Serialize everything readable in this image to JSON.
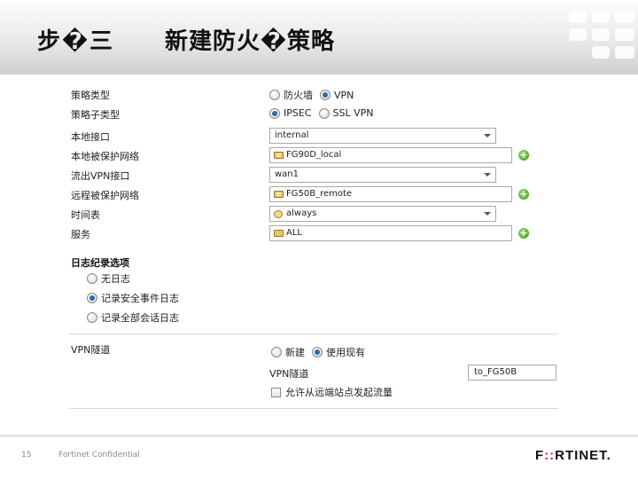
{
  "header": {
    "title_left": "步�三",
    "title_right": "新建防火�策略"
  },
  "form": {
    "policy_type": {
      "label": "策略类型",
      "options": [
        "防火墙",
        "VPN"
      ],
      "selected": "VPN"
    },
    "policy_subtype": {
      "label": "策略子类型",
      "options": [
        "IPSEC",
        "SSL VPN"
      ],
      "selected": "IPSEC"
    },
    "local_interface": {
      "label": "本地接口",
      "value": "internal"
    },
    "local_protected_subnet": {
      "label": "本地被保护网络",
      "value": "FG90D_local"
    },
    "outgoing_vpn_interface": {
      "label": "流出VPN接口",
      "value": "wan1"
    },
    "remote_protected_subnet": {
      "label": "远程被保护网络",
      "value": "FG50B_remote"
    },
    "schedule": {
      "label": "时间表",
      "value": "always"
    },
    "service": {
      "label": "服务",
      "value": "ALL"
    },
    "logging": {
      "title": "日志纪录选项",
      "options": [
        "无日志",
        "记录安全事件日志",
        "记录全部会话日志"
      ],
      "selected": "记录安全事件日志"
    },
    "vpn_tunnel": {
      "label": "VPN隧道",
      "options": [
        "新建",
        "使用现有"
      ],
      "selected": "使用现有",
      "tunnel_label": "VPN隧道",
      "tunnel_value": "to_FG50B",
      "allow_remote_label": "允许从远端站点发起流量"
    }
  },
  "footer": {
    "page_number": "15",
    "confidential": "Fortinet Confidential",
    "logo_text_a": "F",
    "logo_text_b": "::",
    "logo_text_c": "RTINET."
  },
  "colors": {
    "accent": "#2b6aa8",
    "logo_red": "#d01f2e",
    "plus_green": "#3d9a1e"
  },
  "icons": {
    "plus": "plus-circle-icon",
    "address": "address-group-icon",
    "schedule": "clock-icon",
    "service": "service-icon"
  }
}
